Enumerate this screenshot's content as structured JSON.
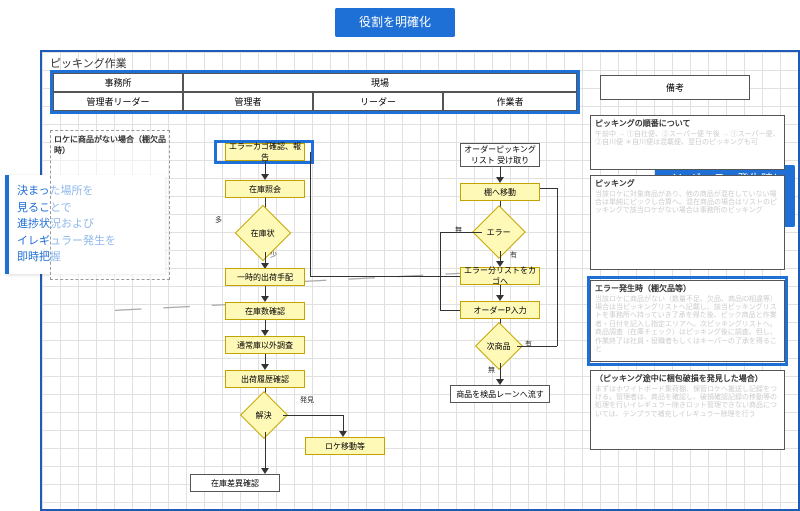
{
  "sheet_title": "ピッキング作業",
  "callouts": {
    "top": "役割を明確化",
    "left": "決まった場所を\n見ることで\n進捗状況および\nイレギュラー発生を\n即時把握",
    "right": "イレギュラー発生時に\n判断をさせない\n作業フロー"
  },
  "lanes": {
    "row1": [
      "事務所",
      "現場"
    ],
    "row2": [
      "管理者リーダー",
      "管理者",
      "リーダー",
      "作業者"
    ],
    "remarks_header": "備考"
  },
  "dash_section_title": "ロケに商品がない場合（棚欠品時）",
  "flow": {
    "b": {
      "n1": "エラーカゴ確認、報告",
      "n2": "在庫照会",
      "d1": "在庫状",
      "n3": "一時的出荷手配",
      "n4": "在庫数確認",
      "n5": "通常庫以外調査",
      "n6": "出荷履歴確認",
      "d2": "解決",
      "n7": "ロケ移動等",
      "n8": "在庫差異確認"
    },
    "d": {
      "n1": "オーダーピッキングリスト\n受け取り",
      "n2": "棚へ移動",
      "d1": "エラー",
      "n3": "エラー分リストをカゴへ",
      "n4": "オーダーP入力",
      "d2": "次商品",
      "n5": "商品を検品レーンへ流す"
    },
    "labels": {
      "many": "多",
      "few": "少",
      "none": "無",
      "has": "有",
      "found": "発見"
    }
  },
  "remarks": [
    {
      "title": "ピッキングの順番について",
      "body": "午前中 → ①自社便、②スーパー便 午後 → ①スーパー便、②自川便 ＊自川便は混載便、翌日のピッキングも可"
    },
    {
      "title": "ピッキング",
      "body": "当該ロケに対象商品があり、他の商品が混在していない場合は単純にピックし合算へ。混在商品の場合はリストのピッキングで該当ロケがない場合は事務所のピッキング"
    },
    {
      "title": "エラー発生時（棚欠品等）",
      "body": "当該ロケに商品がない（数量不足、欠品、商品ID相違等）場合は当ピッキングリストへ記載し、該当ピッキングリストを事務所へ持っていき了承を得た後、ピック商品と作業者・日付を記入し指定エリアへ。次ピッキングリストへ。商品調査（在庫チェック）はピッキング後に調査。但し、作業終了は社員・役職者もしくはキーパーの了承を得ること"
    },
    {
      "title": "（ピッキング途中に梱包破損を発見した場合）",
      "body": "まずはホワイトボード集荷棚、保管ロケへ搬送し記録をつける。管理者は、商品を確認し、破損確認記録の移動等の処理を行いイレギュラー除きロット管理できない商品については、テンプラで補充しイレギュラー除理を行う"
    }
  ]
}
